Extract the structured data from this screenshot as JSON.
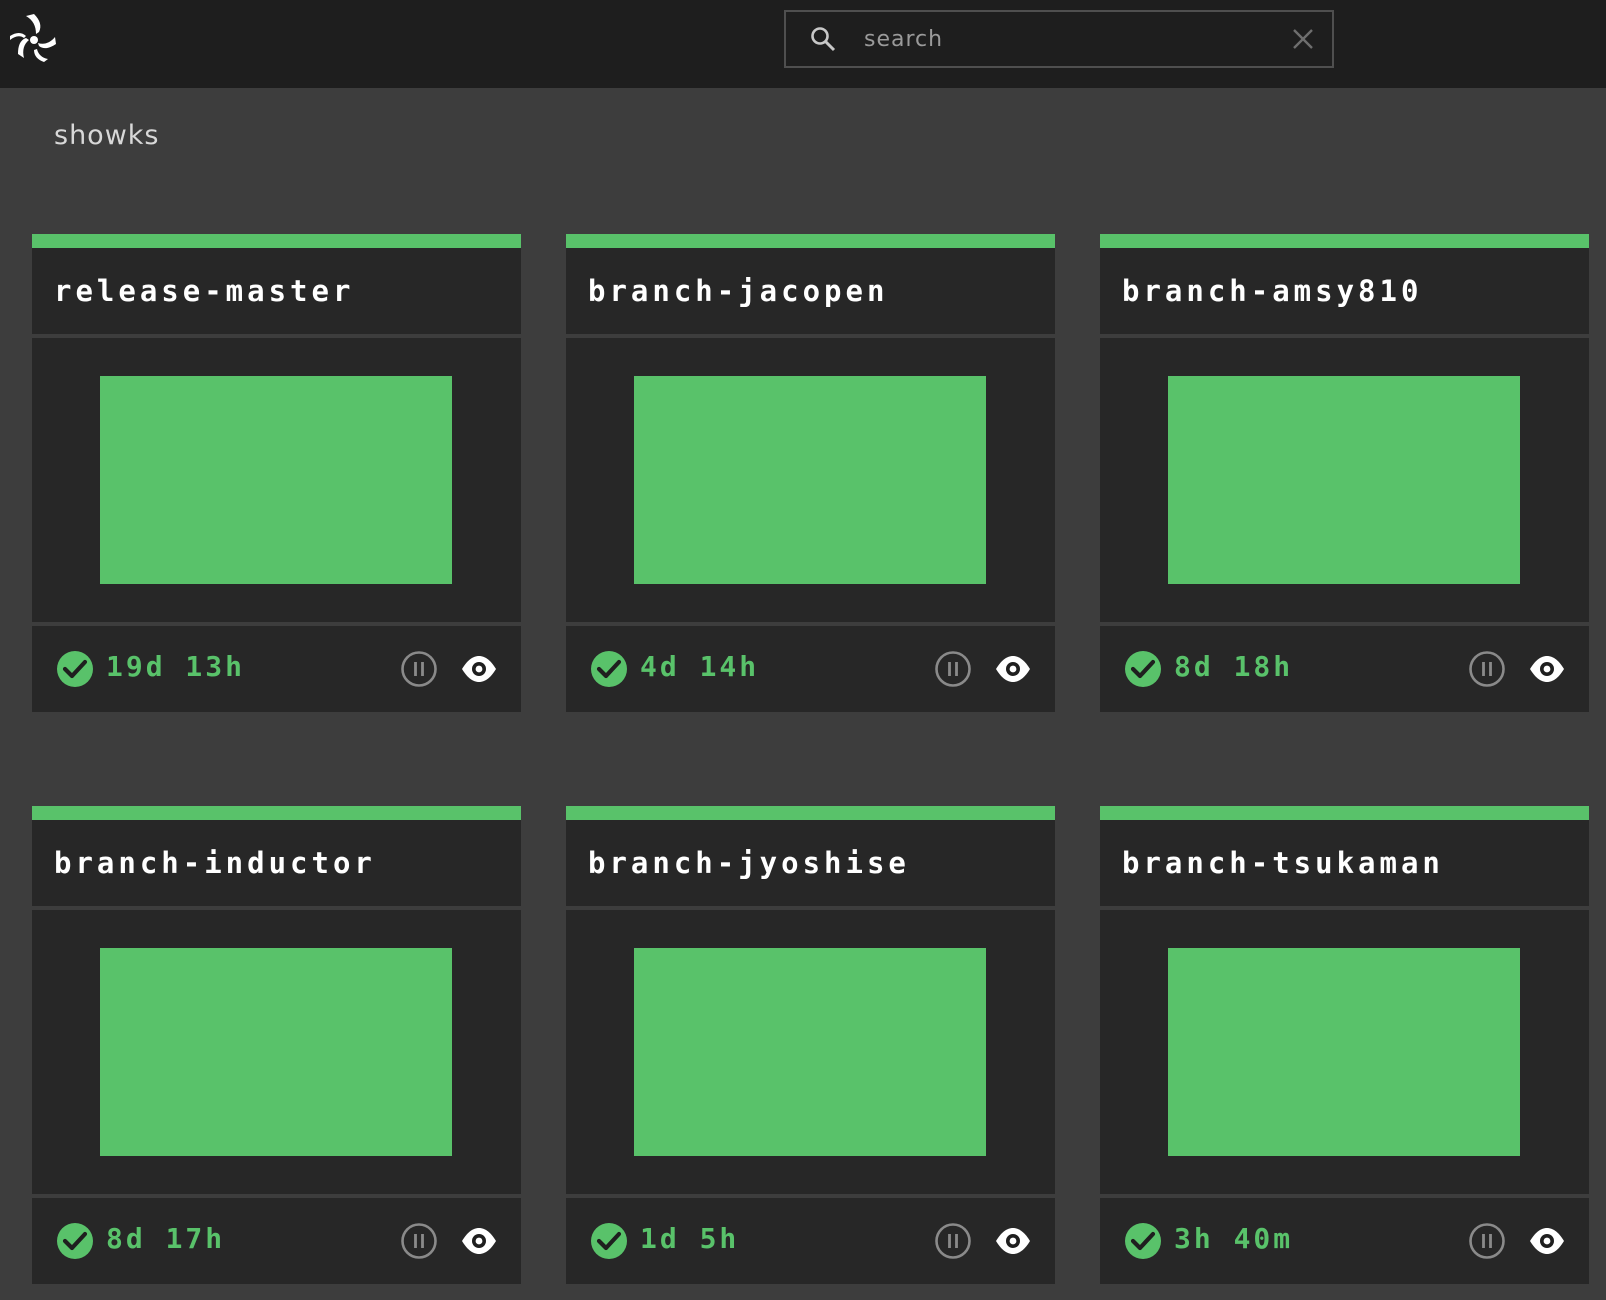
{
  "search": {
    "placeholder": "search"
  },
  "team": {
    "name": "showks"
  },
  "colors": {
    "success": "#59c26a",
    "topbar": "#1e1e1e",
    "card": "#272727",
    "background": "#3d3d3d"
  },
  "pipelines": [
    {
      "name": "release-master",
      "duration": "19d 13h",
      "status": "succeeded"
    },
    {
      "name": "branch-jacopen",
      "duration": "4d 14h",
      "status": "succeeded"
    },
    {
      "name": "branch-amsy810",
      "duration": "8d 18h",
      "status": "succeeded"
    },
    {
      "name": "branch-inductor",
      "duration": "8d 17h",
      "status": "succeeded"
    },
    {
      "name": "branch-jyoshise",
      "duration": "1d 5h",
      "status": "succeeded"
    },
    {
      "name": "branch-tsukaman",
      "duration": "3h 40m",
      "status": "succeeded"
    }
  ],
  "icons": {
    "logo": "concourse-logo-icon",
    "search": "search-icon",
    "clear": "close-icon",
    "status": "check-circle-icon",
    "pause": "pause-circle-icon",
    "visibility": "eye-icon"
  }
}
